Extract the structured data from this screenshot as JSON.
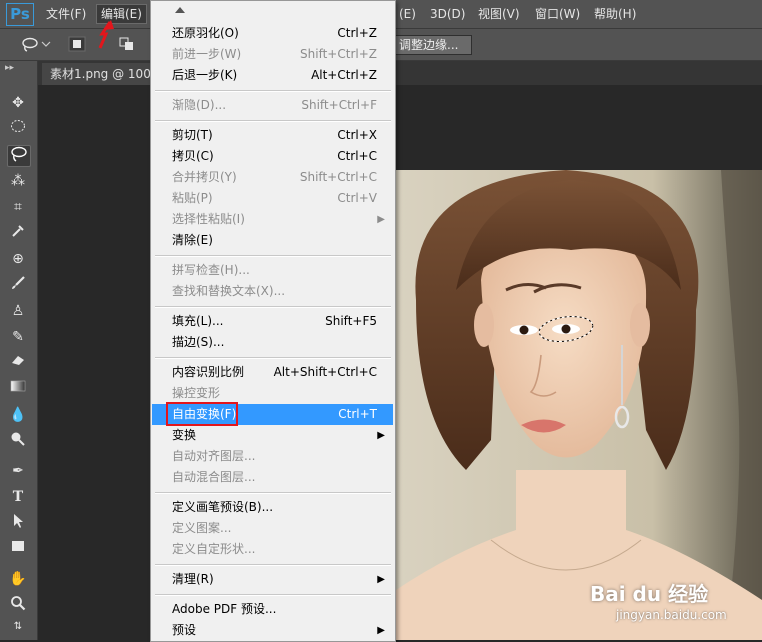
{
  "app": {
    "logo": "Ps"
  },
  "menubar": {
    "items": [
      {
        "label": "文件(F)"
      },
      {
        "label": "编辑(E)"
      },
      {
        "label": "(E)"
      },
      {
        "label": "3D(D)"
      },
      {
        "label": "视图(V)"
      },
      {
        "label": "窗口(W)"
      },
      {
        "label": "帮助(H)"
      }
    ]
  },
  "options": {
    "refine_edge": "调整边缘..."
  },
  "document": {
    "tab_title": "素材1.png @ 100"
  },
  "edit_menu": {
    "items": [
      {
        "label": "还原羽化(O)",
        "shortcut": "Ctrl+Z",
        "enabled": true
      },
      {
        "label": "前进一步(W)",
        "shortcut": "Shift+Ctrl+Z",
        "enabled": false
      },
      {
        "label": "后退一步(K)",
        "shortcut": "Alt+Ctrl+Z",
        "enabled": true
      },
      {
        "label": "渐隐(D)...",
        "shortcut": "Shift+Ctrl+F",
        "enabled": false
      },
      {
        "label": "剪切(T)",
        "shortcut": "Ctrl+X",
        "enabled": true
      },
      {
        "label": "拷贝(C)",
        "shortcut": "Ctrl+C",
        "enabled": true
      },
      {
        "label": "合并拷贝(Y)",
        "shortcut": "Shift+Ctrl+C",
        "enabled": false
      },
      {
        "label": "粘贴(P)",
        "shortcut": "Ctrl+V",
        "enabled": false
      },
      {
        "label": "选择性粘贴(I)",
        "shortcut": "",
        "enabled": false,
        "submenu": true
      },
      {
        "label": "清除(E)",
        "shortcut": "",
        "enabled": true
      },
      {
        "label": "拼写检查(H)...",
        "shortcut": "",
        "enabled": false
      },
      {
        "label": "查找和替换文本(X)...",
        "shortcut": "",
        "enabled": false
      },
      {
        "label": "填充(L)...",
        "shortcut": "Shift+F5",
        "enabled": true
      },
      {
        "label": "描边(S)...",
        "shortcut": "",
        "enabled": true
      },
      {
        "label": "内容识别比例",
        "shortcut": "Alt+Shift+Ctrl+C",
        "enabled": true
      },
      {
        "label": "操控变形",
        "shortcut": "",
        "enabled": false
      },
      {
        "label": "自由变换(F)",
        "shortcut": "Ctrl+T",
        "enabled": true,
        "highlighted": true
      },
      {
        "label": "变换",
        "shortcut": "",
        "enabled": true,
        "submenu": true
      },
      {
        "label": "自动对齐图层...",
        "shortcut": "",
        "enabled": false
      },
      {
        "label": "自动混合图层...",
        "shortcut": "",
        "enabled": false
      },
      {
        "label": "定义画笔预设(B)...",
        "shortcut": "",
        "enabled": true
      },
      {
        "label": "定义图案...",
        "shortcut": "",
        "enabled": false
      },
      {
        "label": "定义自定形状...",
        "shortcut": "",
        "enabled": false
      },
      {
        "label": "清理(R)",
        "shortcut": "",
        "enabled": true,
        "submenu": true
      },
      {
        "label": "Adobe PDF 预设...",
        "shortcut": "",
        "enabled": true
      },
      {
        "label": "预设",
        "shortcut": "",
        "enabled": true,
        "submenu": true
      }
    ]
  },
  "watermark": {
    "brand": "Bai du 经验",
    "url": "jingyan.baidu.com"
  },
  "colors": {
    "highlight": "#3399ff",
    "red_marker": "#e3161c",
    "menu_bg": "#f0f0f0",
    "chrome": "#535353"
  }
}
